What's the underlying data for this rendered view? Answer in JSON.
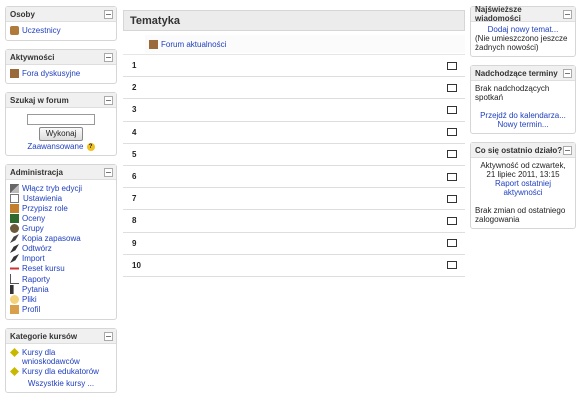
{
  "blocks_left": {
    "people": {
      "title": "Osoby",
      "items": [
        {
          "label": "Uczestnicy",
          "icon": "users-icon"
        }
      ]
    },
    "activities": {
      "title": "Aktywności",
      "items": [
        {
          "label": "Fora dyskusyjne",
          "icon": "forum-icon"
        }
      ]
    },
    "search": {
      "title": "Szukaj w forum",
      "button": "Wykonaj",
      "advanced": "Zaawansowane",
      "value": ""
    },
    "admin": {
      "title": "Administracja",
      "items": [
        {
          "label": "Włącz tryb edycji",
          "icon": "edit-icon"
        },
        {
          "label": "Ustawienia",
          "icon": "settings-icon"
        },
        {
          "label": "Przypisz role",
          "icon": "roles-icon"
        },
        {
          "label": "Oceny",
          "icon": "grades-icon"
        },
        {
          "label": "Grupy",
          "icon": "groups-icon"
        },
        {
          "label": "Kopia zapasowa",
          "icon": "backup-icon"
        },
        {
          "label": "Odtwórz",
          "icon": "restore-icon"
        },
        {
          "label": "Import",
          "icon": "import-icon"
        },
        {
          "label": "Reset kursu",
          "icon": "reset-icon"
        },
        {
          "label": "Raporty",
          "icon": "reports-icon"
        },
        {
          "label": "Pytania",
          "icon": "questions-icon"
        },
        {
          "label": "Pliki",
          "icon": "files-icon"
        },
        {
          "label": "Profil",
          "icon": "profile-icon"
        }
      ]
    },
    "categories": {
      "title": "Kategorie kursów",
      "items": [
        {
          "label": "Kursy dla wnioskodawców"
        },
        {
          "label": "Kursy dla edukatorów"
        }
      ],
      "all": "Wszystkie kursy ..."
    }
  },
  "main": {
    "title": "Tematyka",
    "news_forum": "Forum aktualności",
    "sections": [
      "1",
      "2",
      "3",
      "4",
      "5",
      "6",
      "7",
      "8",
      "9",
      "10"
    ]
  },
  "blocks_right": {
    "news": {
      "title": "Najświeższe wiadomości",
      "add": "Dodaj nowy temat...",
      "none": "(Nie umieszczono jeszcze żadnych nowości)"
    },
    "upcoming": {
      "title": "Nadchodzące terminy",
      "none": "Brak nadchodzących spotkań",
      "calendar": "Przejdź do kalendarza...",
      "new": "Nowy termin..."
    },
    "recent": {
      "title": "Co się ostatnio działo?",
      "since": "Aktywność od czwartek, 21 lipiec 2011, 13:15",
      "report": "Raport ostatniej aktywności",
      "nochanges": "Brak zmian od ostatniego zalogowania"
    }
  }
}
